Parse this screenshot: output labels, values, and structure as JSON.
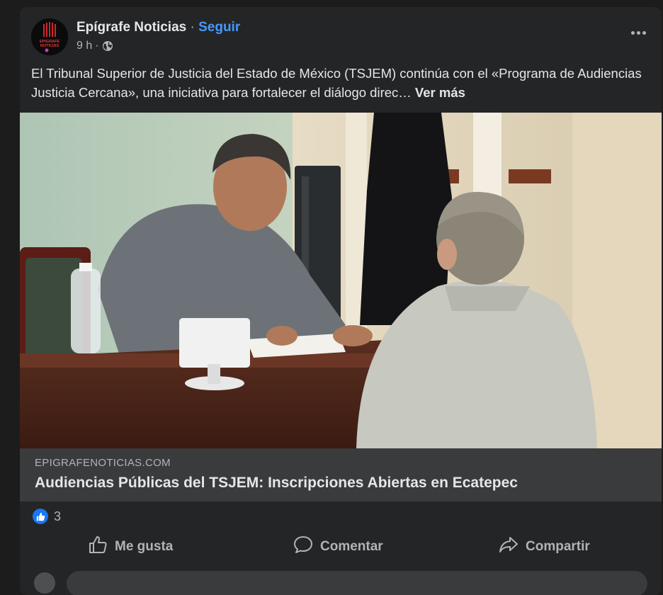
{
  "post": {
    "page_name": "Epígrafe Noticias",
    "separator": "·",
    "follow_label": "Seguir",
    "time": "9 h",
    "time_separator": "·",
    "privacy_icon": "globe-icon",
    "text": "El Tribunal Superior de Justicia del Estado de México (TSJEM) continúa con el «Programa de Audiencias Justicia Cercana», una iniciativa para fortalecer el diálogo direc…",
    "see_more_label": "Ver más",
    "avatar_lines": [
      "EPIGRAFE",
      "NOTICIAS"
    ]
  },
  "link_preview": {
    "domain": "EPIGRAFENOTICIAS.COM",
    "title": "Audiencias Públicas del TSJEM: Inscripciones Abiertas en Ecatepec"
  },
  "reactions": {
    "icon": "like-icon",
    "count": "3"
  },
  "actions": {
    "like_label": "Me gusta",
    "comment_label": "Comentar",
    "share_label": "Compartir"
  },
  "colors": {
    "background": "#1c1c1d",
    "card": "#242526",
    "link_box": "#3a3b3c",
    "follow": "#4599ff",
    "like_badge": "#1877f2"
  }
}
